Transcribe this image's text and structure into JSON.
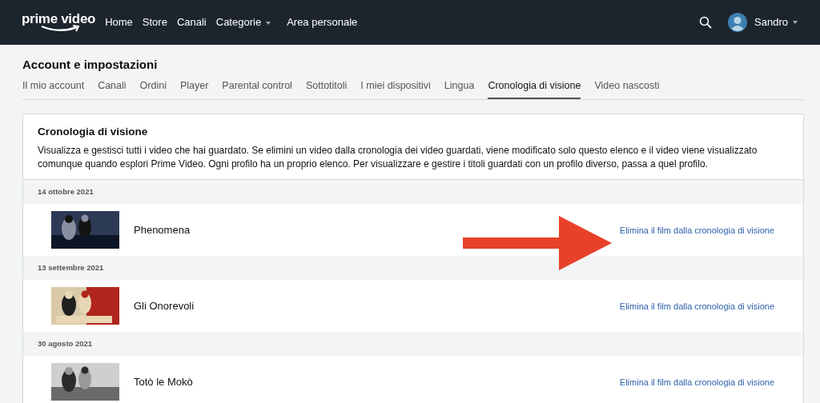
{
  "navbar": {
    "logo": "prime video",
    "links": [
      {
        "label": "Home",
        "dropdown": false
      },
      {
        "label": "Store",
        "dropdown": false
      },
      {
        "label": "Canali",
        "dropdown": false
      },
      {
        "label": "Categorie",
        "dropdown": true
      },
      {
        "label": "Area personale",
        "dropdown": false
      }
    ],
    "user": {
      "name": "Sandro"
    }
  },
  "page_title": "Account e impostazioni",
  "tabs": [
    {
      "label": "Il mio account",
      "selected": false
    },
    {
      "label": "Canali",
      "selected": false
    },
    {
      "label": "Ordini",
      "selected": false
    },
    {
      "label": "Player",
      "selected": false
    },
    {
      "label": "Parental control",
      "selected": false
    },
    {
      "label": "Sottotitoli",
      "selected": false
    },
    {
      "label": "I miei dispositivi",
      "selected": false
    },
    {
      "label": "Lingua",
      "selected": false
    },
    {
      "label": "Cronologia di visione",
      "selected": true
    },
    {
      "label": "Video nascosti",
      "selected": false
    }
  ],
  "section": {
    "title": "Cronologia di visione",
    "description": "Visualizza e gestisci tutti i video che hai guardato. Se elimini un video dalla cronologia dei video guardati, viene modificato solo questo elenco e il video viene visualizzato comunque quando esplori Prime Video. Ogni profilo ha un proprio elenco. Per visualizzare e gestire i titoli guardati con un profilo diverso, passa a quel profilo.",
    "entries": [
      {
        "date": "14 ottobre 2021",
        "title": "Phenomena",
        "action": "Elimina il film dalla cronologia di visione"
      },
      {
        "date": "13 settembre 2021",
        "title": "Gli Onorevoli",
        "action": "Elimina il film dalla cronologia di visione"
      },
      {
        "date": "30 agosto 2021",
        "title": "Totò le Mokò",
        "action": "Elimina il film dalla cronologia di visione"
      }
    ]
  }
}
